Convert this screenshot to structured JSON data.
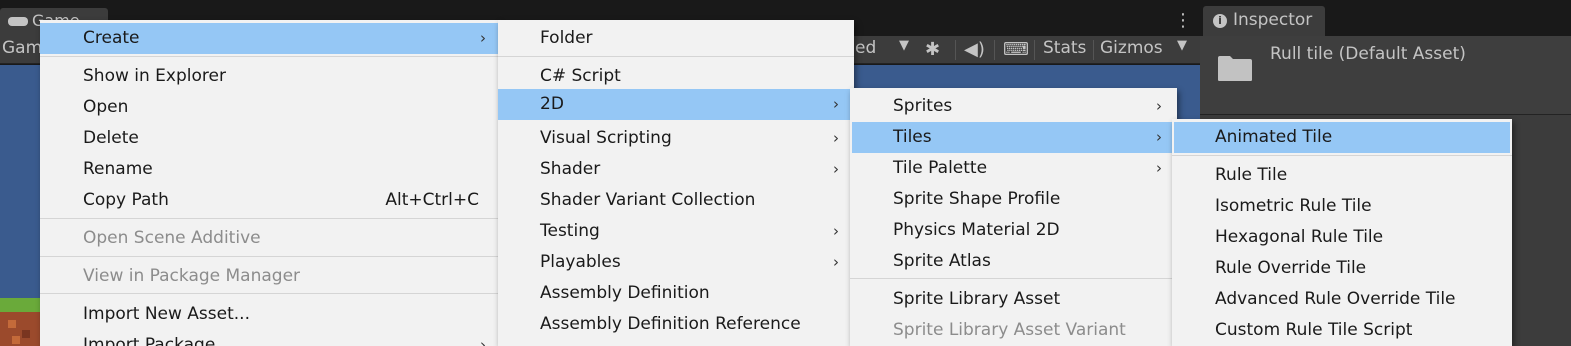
{
  "editor": {
    "game_tab": "Game",
    "toolbar_left_fragment": "Gam",
    "toolbar_ed_fragment": "ed",
    "stats_label": "Stats",
    "gizmos_label": "Gizmos",
    "inspector_tab": "Inspector",
    "inspector_title": "Rull tile (Default Asset)",
    "game_view_color": "#3a5b8e"
  },
  "menu1": {
    "items": [
      {
        "label": "Create",
        "submenu": "›"
      },
      {
        "label": "Show in Explorer"
      },
      {
        "label": "Open"
      },
      {
        "label": "Delete"
      },
      {
        "label": "Rename"
      },
      {
        "label": "Copy Path",
        "shortcut": "Alt+Ctrl+C"
      },
      {
        "label": "Open Scene Additive"
      },
      {
        "label": "View in Package Manager"
      },
      {
        "label": "Import New Asset..."
      },
      {
        "label": "Import Package",
        "submenu": "›"
      }
    ]
  },
  "menu2": {
    "items": [
      {
        "label": "Folder"
      },
      {
        "label": "C# Script"
      },
      {
        "label": "2D",
        "submenu": "›"
      },
      {
        "label": "Visual Scripting",
        "submenu": "›"
      },
      {
        "label": "Shader",
        "submenu": "›"
      },
      {
        "label": "Shader Variant Collection"
      },
      {
        "label": "Testing",
        "submenu": "›"
      },
      {
        "label": "Playables",
        "submenu": "›"
      },
      {
        "label": "Assembly Definition"
      },
      {
        "label": "Assembly Definition Reference"
      }
    ]
  },
  "menu3": {
    "items": [
      {
        "label": "Sprites",
        "submenu": "›"
      },
      {
        "label": "Tiles",
        "submenu": "›"
      },
      {
        "label": "Tile Palette",
        "submenu": "›"
      },
      {
        "label": "Sprite Shape Profile"
      },
      {
        "label": "Physics Material 2D"
      },
      {
        "label": "Sprite Atlas"
      },
      {
        "label": "Sprite Library Asset"
      },
      {
        "label": "Sprite Library Asset Variant"
      }
    ]
  },
  "menu4": {
    "items": [
      {
        "label": "Animated Tile"
      },
      {
        "label": "Rule Tile"
      },
      {
        "label": "Isometric Rule Tile"
      },
      {
        "label": "Hexagonal Rule Tile"
      },
      {
        "label": "Rule Override Tile"
      },
      {
        "label": "Advanced Rule Override Tile"
      },
      {
        "label": "Custom Rule Tile Script"
      }
    ]
  },
  "colors": {
    "highlight": "#95c7f5",
    "menu_bg": "#f2f2f2",
    "disabled_text": "#8c8c8c",
    "editor_panel": "#3c3c3c"
  }
}
